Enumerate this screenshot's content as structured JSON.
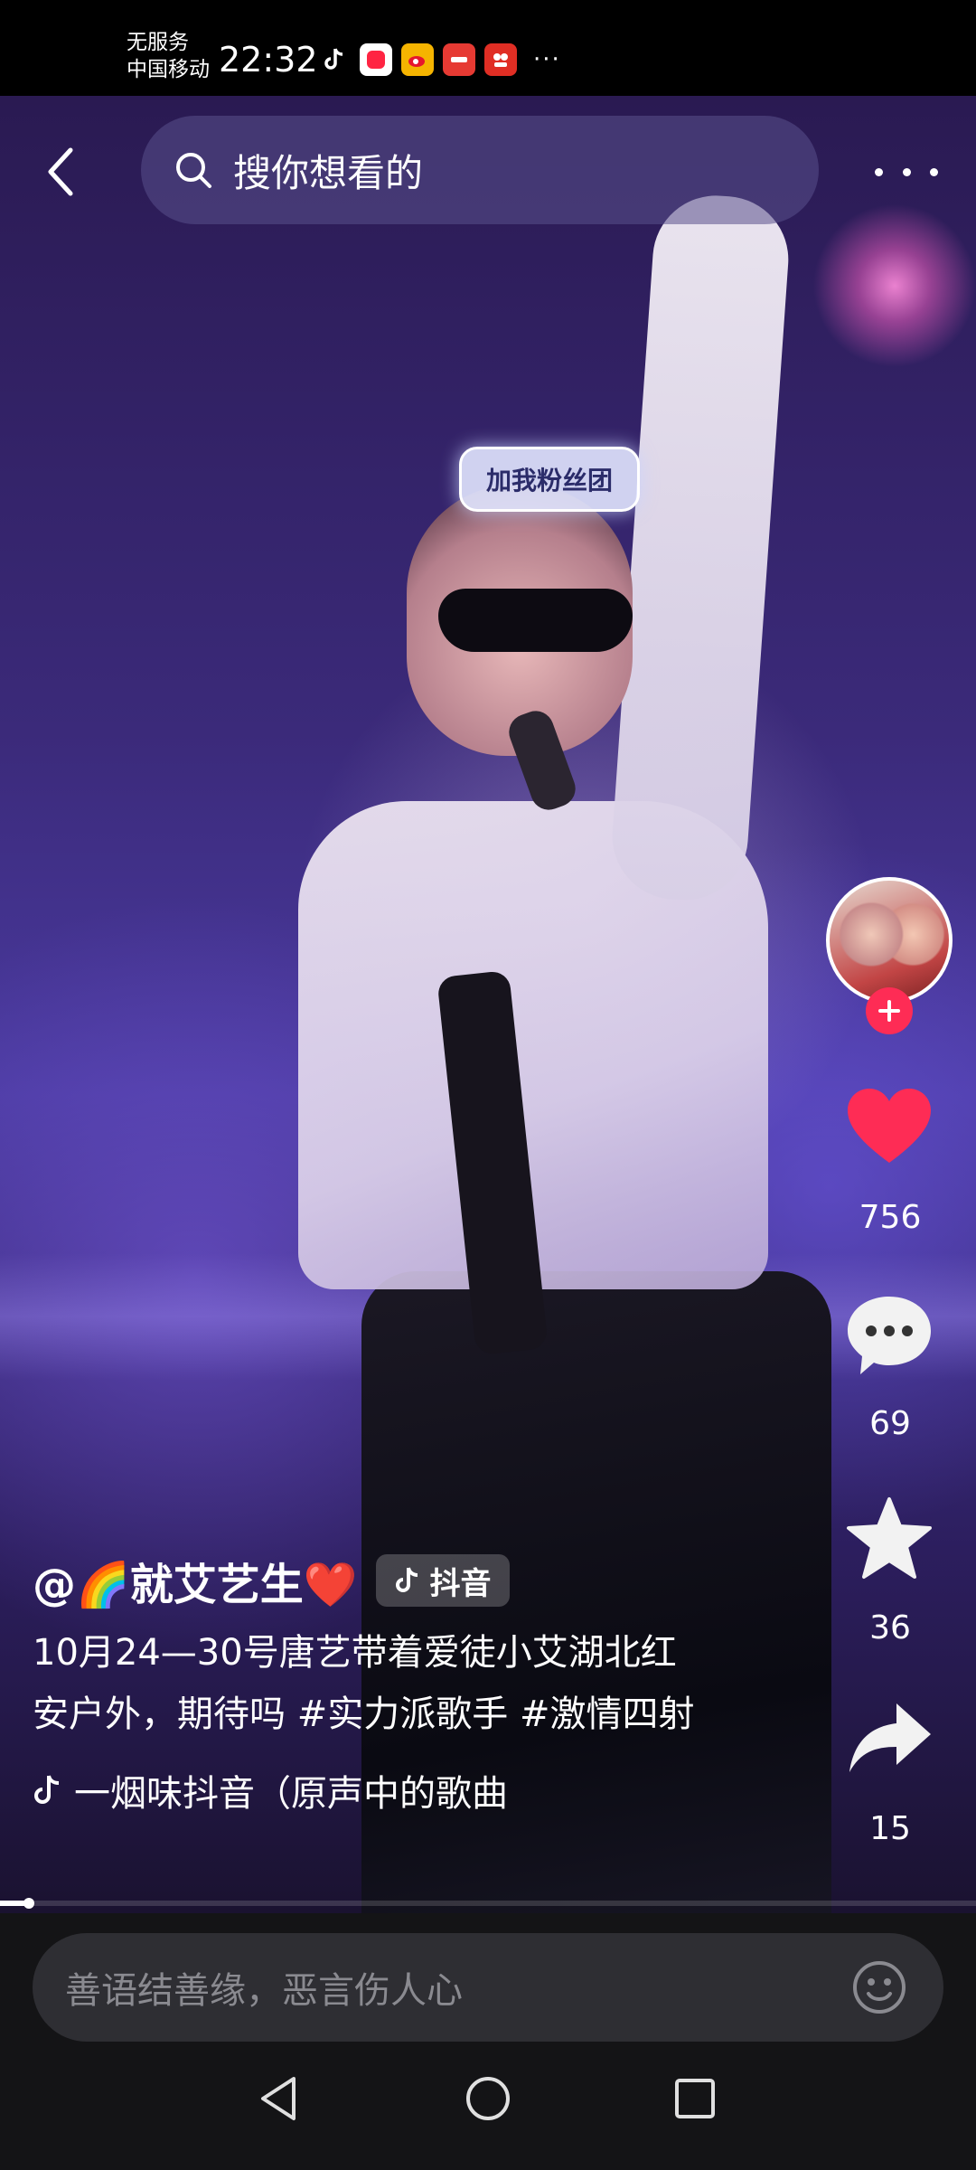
{
  "status_bar": {
    "carrier_line1": "无服务",
    "carrier_line2": "中国移动",
    "time": "22:32",
    "app_icons": [
      "tiktok-icon",
      "xiaohongshu-icon",
      "weibo-icon",
      "huawei-icon",
      "pinduoduo-icon"
    ],
    "overflow": "···"
  },
  "top_bar": {
    "search_placeholder": "搜你想看的"
  },
  "video": {
    "fan_sign": "加我粉丝团"
  },
  "actions": {
    "like_count": "756",
    "comment_count": "69",
    "favorite_count": "36",
    "share_count": "15",
    "like_color": "#fe2c55"
  },
  "caption": {
    "author": "@🌈就艾艺生❤️",
    "badge": "抖音",
    "description": "10月24—30号唐艺带着爱徒小艾湖北红安户外，期待吗 #实力派歌手 #激情四射",
    "music": "一烟味抖音（原声中的歌曲"
  },
  "progress": {
    "fraction": 0.03
  },
  "comment_bar": {
    "placeholder": "善语结善缘，恶言伤人心"
  }
}
